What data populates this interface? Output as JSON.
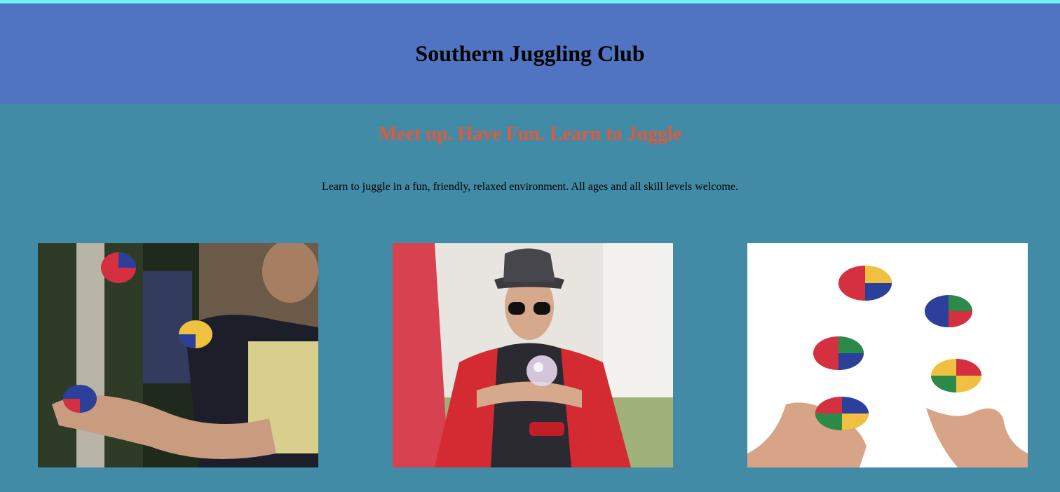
{
  "header": {
    "title": "Southern Juggling Club"
  },
  "main": {
    "tagline": "Meet up. Have Fun. Learn to Juggle",
    "intro": "Learn to juggle in a fun, friendly, relaxed environment. All ages and all skill levels welcome."
  },
  "gallery": {
    "photos": [
      {
        "subject": "man-juggling-beanbags-photo"
      },
      {
        "subject": "performer-with-contact-ball-photo"
      },
      {
        "subject": "hands-with-juggling-balls-photo"
      }
    ]
  },
  "colors": {
    "top_line": "#6ef2f5",
    "header_bg": "#5074c2",
    "page_bg": "#418ba6",
    "tagline": "#e0593a"
  }
}
